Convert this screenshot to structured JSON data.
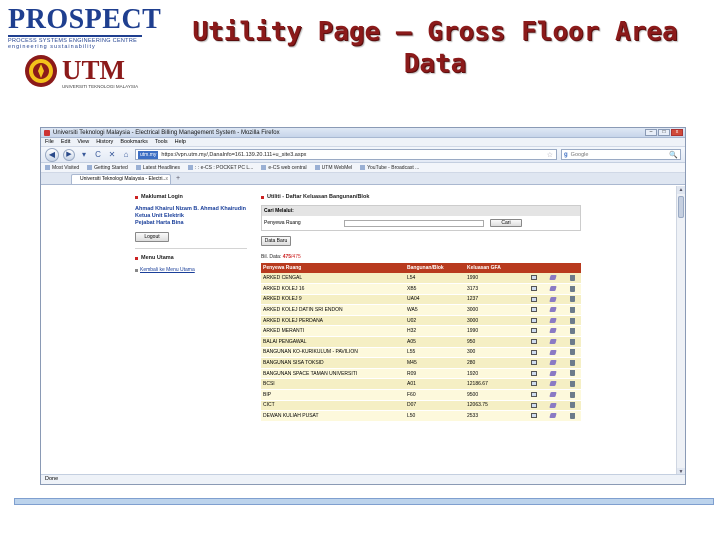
{
  "slide": {
    "title": "Utility Page – Gross Floor Area Data",
    "logos": {
      "prospect_word": "PROSPECT",
      "prospect_sub1": "PROCESS SYSTEMS ENGINEERING CENTRE",
      "prospect_sub2": "engineering sustainability",
      "utm_word": "UTM",
      "utm_sub": "UNIVERSITI TEKNOLOGI MALAYSIA"
    }
  },
  "browser": {
    "window_title": "Universiti Teknologi Malaysia - Electrical Billing Management System - Mozilla Firefox",
    "menu": [
      "File",
      "Edit",
      "View",
      "History",
      "Bookmarks",
      "Tools",
      "Help"
    ],
    "site_badge": "utm.my",
    "url": "https://vpn.utm.my/,DanaInfo=161.139.20.111+u_site3.aspx",
    "search_placeholder": "Google",
    "search_engine_letter": "g",
    "bookmarks": [
      "Most Visited",
      "Getting Started",
      "Latest Headlines",
      ": : e-CS : POCKET PC L...",
      "e-CS web central",
      "UTM WebMel",
      "YouTube - Broadcast ..."
    ],
    "tab_title": "Universiti Teknologi Malaysia - Electri...",
    "status": "Done",
    "window_buttons": [
      "–",
      "□",
      "x"
    ],
    "nav_icons": {
      "back": "◀",
      "forward": "▶",
      "dropdown": "▾",
      "reload": "C",
      "stop": "✕",
      "home": "⌂",
      "star": "☆",
      "search": "🔍",
      "new_tab": "+",
      "tab_close": "x",
      "scroll_up": "▲",
      "scroll_down": "▼"
    }
  },
  "page": {
    "login_section": "Maklumat Login",
    "user_name": "Ahmad Khairul Nizam B. Ahmad Khairudin",
    "user_role": "Ketua Unit Elektrik",
    "user_office": "Pejabat Harta Bina",
    "logout_label": "Logout",
    "menu_section": "Menu Utama",
    "menu_link": "Kembali ke Menu Utama",
    "utility_title": "Utiliti - Daftar Keluasan Bangunan/Blok",
    "search_head": "Cari Melalui:",
    "search_label": "Penyewa Ruang",
    "search_value": "",
    "cari_label": "Cari",
    "data_baru_label": "Data Baru",
    "count_prefix": "Bil. Data:",
    "count_shown": "475",
    "count_total": "/475",
    "columns": [
      "Penyewa Ruang",
      "Bangunan/Blok",
      "Keluasan GFA",
      "",
      "",
      ""
    ],
    "rows": [
      [
        "ARKED CENGAL",
        "L54",
        "1990"
      ],
      [
        "ARKED KOLEJ 16",
        "XB5",
        "3173"
      ],
      [
        "ARKED KOLEJ 9",
        "UA04",
        "1237"
      ],
      [
        "ARKED KOLEJ DATIN SRI ENDON",
        "WA5",
        "3000"
      ],
      [
        "ARKED KOLEJ PERDANA",
        "U02",
        "3000"
      ],
      [
        "ARKED MERANTI",
        "H32",
        "1990"
      ],
      [
        "BALAI PENGAWAL",
        "A05",
        "950"
      ],
      [
        "BANGUNAN KO-KURIKULUM - PAVILION",
        "L55",
        "300"
      ],
      [
        "BANGUNAN SISA TOKSID",
        "M45",
        "280"
      ],
      [
        "BANGUNAN SPACE TAMAN UNIVERSITI",
        "R09",
        "1920"
      ],
      [
        "BCSI",
        "A01",
        "12186.67"
      ],
      [
        "BIP",
        "F60",
        "9500"
      ],
      [
        "CICT",
        "D07",
        "12063.75"
      ],
      [
        "DEWAN KULIAH PUSAT",
        "L50",
        "2533"
      ]
    ]
  }
}
